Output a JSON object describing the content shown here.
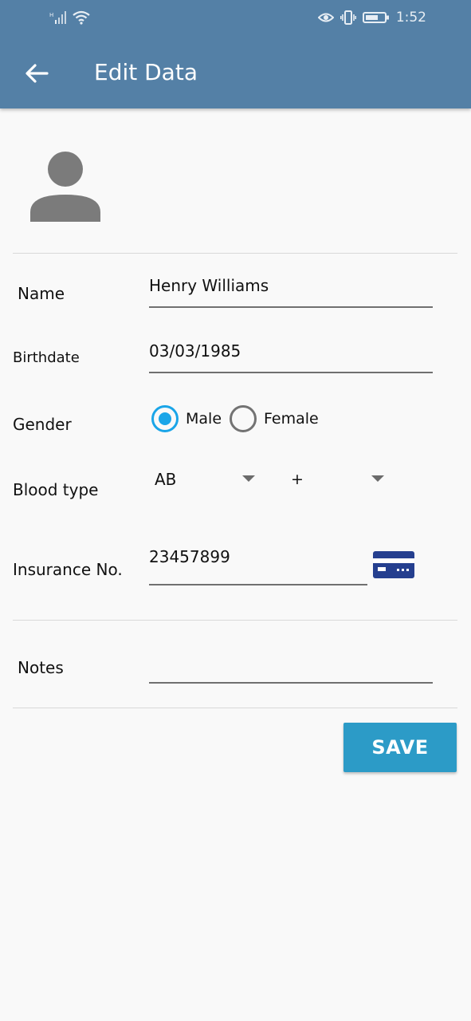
{
  "status_bar": {
    "time": "1:52"
  },
  "app_bar": {
    "title": "Edit Data"
  },
  "form": {
    "name": {
      "label": "Name",
      "value": "Henry Williams"
    },
    "birthdate": {
      "label": "Birthdate",
      "value": "03/03/1985"
    },
    "gender": {
      "label": "Gender",
      "options": [
        "Male",
        "Female"
      ],
      "selected": "Male"
    },
    "blood_type": {
      "label": "Blood type",
      "group": "AB",
      "rh": "+"
    },
    "insurance": {
      "label": "Insurance No.",
      "value": "23457899",
      "icon": "credit-card-icon"
    },
    "notes": {
      "label": "Notes",
      "value": ""
    }
  },
  "actions": {
    "save_label": "SAVE"
  },
  "colors": {
    "app_bar": "#5480a6",
    "accent": "#1aa5e8",
    "save_button": "#2c9bc7",
    "card_icon": "#253f8f"
  }
}
